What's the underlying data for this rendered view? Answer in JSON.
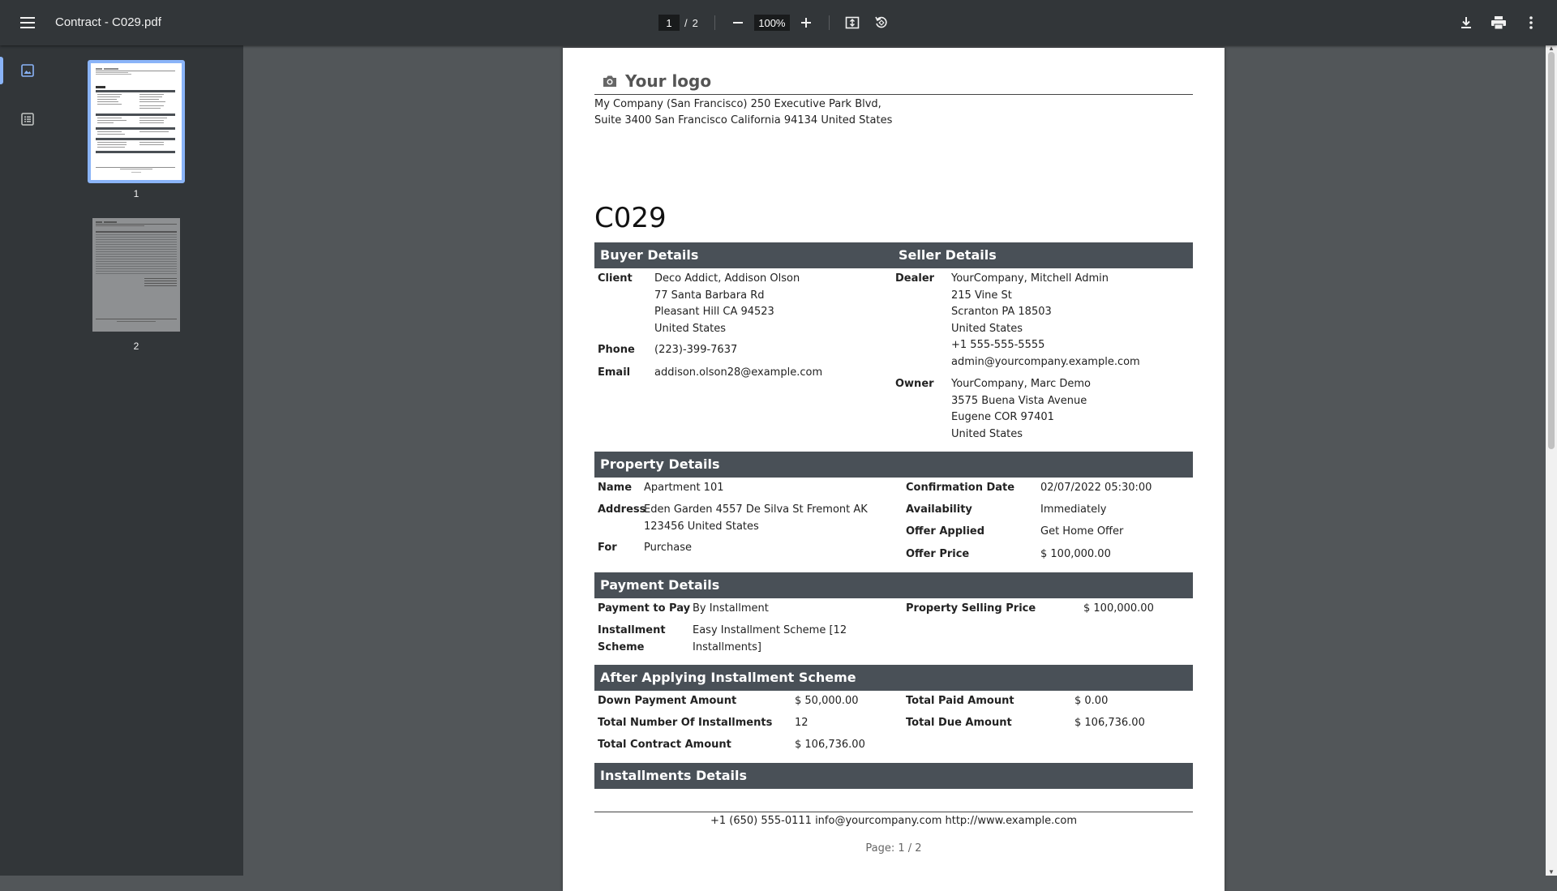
{
  "toolbar": {
    "title": "Contract - C029.pdf",
    "current_page": "1",
    "page_separator": "/",
    "total_pages": "2",
    "zoom": "100%"
  },
  "sidebar": {
    "thumbnails": [
      {
        "label": "1",
        "selected": true
      },
      {
        "label": "2",
        "selected": false
      }
    ]
  },
  "document": {
    "logo_text": "Your logo",
    "company_address_line1": "My Company (San Francisco) 250 Executive Park Blvd,",
    "company_address_line2": "Suite 3400 San Francisco California 94134 United States",
    "title": "C029",
    "buyer": {
      "heading": "Buyer Details",
      "client_label": "Client",
      "client_lines": [
        "Deco Addict, Addison Olson",
        "77 Santa Barbara Rd",
        "Pleasant Hill CA 94523",
        "United States"
      ],
      "phone_label": "Phone",
      "phone": "(223)-399-7637",
      "email_label": "Email",
      "email": "addison.olson28@example.com"
    },
    "seller": {
      "heading": "Seller Details",
      "dealer_label": "Dealer",
      "dealer_lines": [
        "YourCompany, Mitchell Admin",
        "215 Vine St",
        "Scranton PA 18503",
        "United States",
        "+1 555-555-5555",
        "admin@yourcompany.example.com"
      ],
      "owner_label": "Owner",
      "owner_lines": [
        "YourCompany, Marc Demo",
        "3575 Buena Vista Avenue",
        "Eugene COR 97401",
        "United States"
      ]
    },
    "property": {
      "heading": "Property Details",
      "name_label": "Name",
      "name": "Apartment 101",
      "address_label": "Address",
      "address_line1": "Eden Garden 4557 De Silva St Fremont AK",
      "address_line2": "123456 United States",
      "for_label": "For",
      "for": "Purchase",
      "confirmation_label": "Confirmation Date",
      "confirmation": "02/07/2022 05:30:00",
      "availability_label": "Availability",
      "availability": "Immediately",
      "offer_applied_label": "Offer Applied",
      "offer_applied": "Get Home Offer",
      "offer_price_label": "Offer Price",
      "offer_price": "$ 100,000.00"
    },
    "payment": {
      "heading": "Payment Details",
      "pay_label": "Payment to Pay",
      "pay": "By Installment",
      "scheme_label_line1": "Installment",
      "scheme_label_line2": "Scheme",
      "scheme_line1": "Easy Installment Scheme [12",
      "scheme_line2": "Installments]",
      "selling_price_label": "Property Selling Price",
      "selling_price": "$ 100,000.00"
    },
    "after_scheme": {
      "heading": "After Applying Installment Scheme",
      "down_payment_label": "Down Payment Amount",
      "down_payment": "$ 50,000.00",
      "num_installments_label": "Total Number Of Installments",
      "num_installments": "12",
      "contract_amount_label": "Total Contract Amount",
      "contract_amount": "$ 106,736.00",
      "paid_label": "Total Paid Amount",
      "paid": "$ 0.00",
      "due_label": "Total Due Amount",
      "due": "$ 106,736.00"
    },
    "installments": {
      "heading": "Installments Details"
    },
    "footer": "+1 (650) 555-0111 info@yourcompany.com http://www.example.com",
    "page_number": "Page: 1 / 2"
  }
}
